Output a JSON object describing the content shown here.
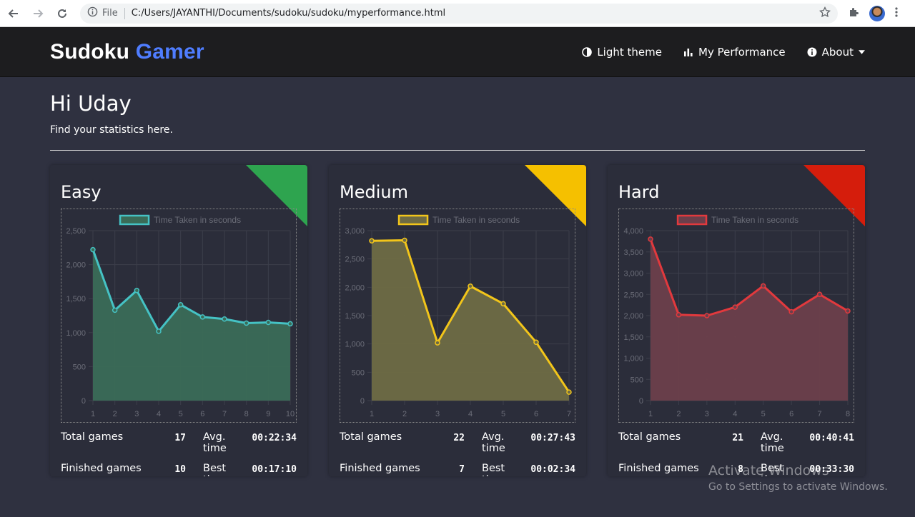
{
  "browser": {
    "file_label": "File",
    "url": "C:/Users/JAYANTHI/Documents/sudoku/sudoku/myperformance.html"
  },
  "navbar": {
    "brand_part1": "Sudoku",
    "brand_part2": "Gamer",
    "items": [
      {
        "label": "Light theme",
        "icon": "half-circle-icon"
      },
      {
        "label": "My Performance",
        "icon": "bar-chart-icon"
      },
      {
        "label": "About",
        "icon": "info-icon"
      }
    ]
  },
  "page": {
    "greeting": "Hi Uday",
    "subtitle": "Find your statistics here."
  },
  "cards": [
    {
      "title": "Easy",
      "accent": "#2ea44f",
      "stats": {
        "total_label": "Total games",
        "total": "17",
        "avg_label": "Avg. time",
        "avg": "00:22:34",
        "finished_label": "Finished games",
        "finished": "10",
        "best_label": "Best time",
        "best": "00:17:10"
      }
    },
    {
      "title": "Medium",
      "accent": "#f5c000",
      "stats": {
        "total_label": "Total games",
        "total": "22",
        "avg_label": "Avg. time",
        "avg": "00:27:43",
        "finished_label": "Finished games",
        "finished": "7",
        "best_label": "Best time",
        "best": "00:02:34"
      }
    },
    {
      "title": "Hard",
      "accent": "#d51d0c",
      "stats": {
        "total_label": "Total games",
        "total": "21",
        "avg_label": "Avg. time",
        "avg": "00:40:41",
        "finished_label": "Finished games",
        "finished": "8",
        "best_label": "Best time",
        "best": "00:33:30"
      }
    }
  ],
  "chart_data": [
    {
      "type": "area",
      "legend_label": "Time Taken in seconds",
      "line_color": "#45c2c4",
      "fill_color": "#3a6b57",
      "x": [
        1,
        2,
        3,
        4,
        5,
        6,
        7,
        8,
        9,
        10
      ],
      "values": [
        2220,
        1330,
        1620,
        1020,
        1410,
        1230,
        1200,
        1140,
        1150,
        1130
      ],
      "ylim": [
        0,
        2500
      ],
      "yticks": [
        "0",
        "500",
        "1,000",
        "1,500",
        "2,000",
        "2,500"
      ],
      "grid": true,
      "legend_position": "top"
    },
    {
      "type": "area",
      "legend_label": "Time Taken in seconds",
      "line_color": "#f2c51a",
      "fill_color": "#6e6b44",
      "x": [
        1,
        2,
        3,
        4,
        5,
        6,
        7
      ],
      "values": [
        2820,
        2830,
        1020,
        2020,
        1710,
        1030,
        150
      ],
      "ylim": [
        0,
        3000
      ],
      "yticks": [
        "0",
        "500",
        "1,000",
        "1,500",
        "2,000",
        "2,500",
        "3,000"
      ],
      "grid": true,
      "legend_position": "top"
    },
    {
      "type": "area",
      "legend_label": "Time Taken in seconds",
      "line_color": "#e2393d",
      "fill_color": "#6b3f4b",
      "x": [
        1,
        2,
        3,
        4,
        5,
        6,
        7,
        8
      ],
      "values": [
        3800,
        2020,
        2000,
        2200,
        2700,
        2090,
        2500,
        2110
      ],
      "ylim": [
        0,
        4000
      ],
      "yticks": [
        "0",
        "500",
        "1,000",
        "1,500",
        "2,000",
        "2,500",
        "3,000",
        "3,500",
        "4,000"
      ],
      "grid": true,
      "legend_position": "top"
    }
  ],
  "watermark": {
    "line1": "Activate Windows",
    "line2": "Go to Settings to activate Windows."
  }
}
